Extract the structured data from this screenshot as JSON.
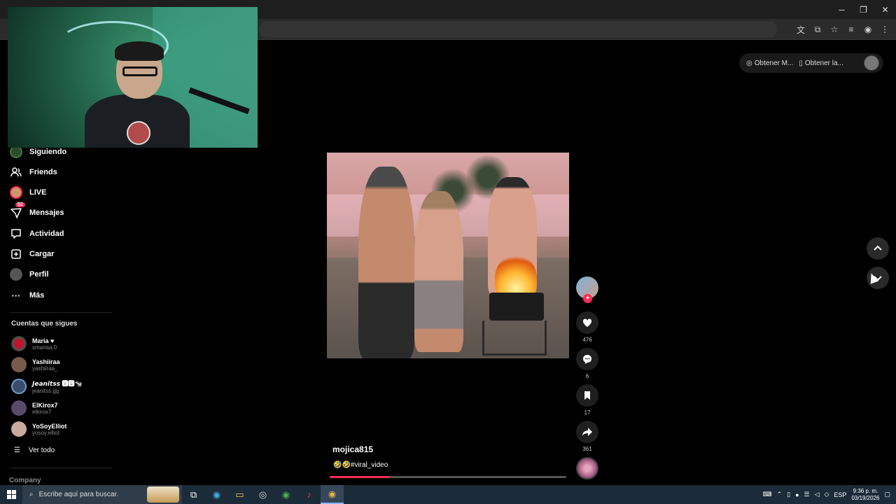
{
  "browser": {
    "window_controls": {
      "minimize": "─",
      "restore": "❐",
      "close": "✕"
    }
  },
  "topbar": {
    "get_coins_label": "Obtener M...",
    "get_app_label": "Obtener la..."
  },
  "sidebar": {
    "items": [
      {
        "label": "Siguiendo",
        "icon": "following-avatar-icon"
      },
      {
        "label": "Friends",
        "icon": "friends-icon"
      },
      {
        "label": "LIVE",
        "icon": "live-avatar-icon"
      },
      {
        "label": "Mensajes",
        "icon": "messages-icon",
        "badge": "52"
      },
      {
        "label": "Actividad",
        "icon": "activity-icon"
      },
      {
        "label": "Cargar",
        "icon": "upload-icon"
      },
      {
        "label": "Perfil",
        "icon": "profile-avatar-icon"
      },
      {
        "label": "Más",
        "icon": "more-icon"
      }
    ],
    "following_title": "Cuentas que sigues",
    "accounts": [
      {
        "name": "Maria ♥",
        "user": "smariaa.0"
      },
      {
        "name": "Yashiiraa",
        "user": "yashiiraa_"
      },
      {
        "name": "𝙅𝙚𝙖𝙣𝙞𝙩𝙨𝙨 🆅🅴🐄",
        "user": "jeanitss.gg"
      },
      {
        "name": "ElKirox7",
        "user": "elkirox7"
      },
      {
        "name": "YoSoyElliot",
        "user": "yosoy.elliot"
      }
    ],
    "see_all": "Ver todo",
    "company": "Company"
  },
  "video": {
    "author": "mojica815",
    "caption": "🤣🤣#viral_video",
    "progress_fraction": 0.25
  },
  "actions": {
    "likes": "476",
    "comments": "6",
    "saves": "17",
    "shares": "361"
  },
  "taskbar": {
    "search_placeholder": "Escribe aquí para buscar.",
    "lang": "ESP",
    "time": "9:36 p. m.",
    "date": "03/19/2026"
  }
}
